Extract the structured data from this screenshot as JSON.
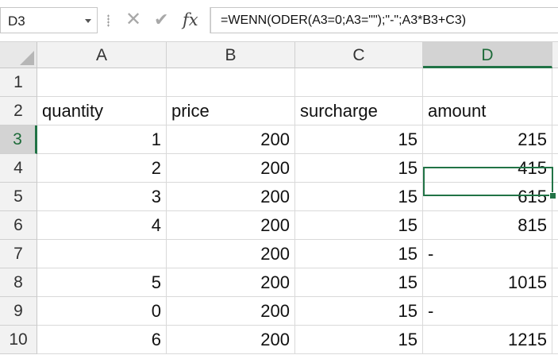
{
  "formula_bar": {
    "name_box": "D3",
    "cancel_icon": "cancel-x-icon",
    "enter_icon": "check-icon",
    "function_icon": "fx",
    "formula": "=WENN(ODER(A3=0;A3=\"\");\"-\";A3*B3+C3)"
  },
  "columns": [
    "A",
    "B",
    "C",
    "D"
  ],
  "selected_column": "D",
  "rows": [
    {
      "num": "1",
      "cells": [
        "",
        "",
        "",
        ""
      ]
    },
    {
      "num": "2",
      "cells": [
        "quantity",
        "price",
        "surcharge",
        "amount"
      ]
    },
    {
      "num": "3",
      "cells": [
        "1",
        "200",
        "15",
        "215"
      ]
    },
    {
      "num": "4",
      "cells": [
        "2",
        "200",
        "15",
        "415"
      ]
    },
    {
      "num": "5",
      "cells": [
        "3",
        "200",
        "15",
        "615"
      ]
    },
    {
      "num": "6",
      "cells": [
        "4",
        "200",
        "15",
        "815"
      ]
    },
    {
      "num": "7",
      "cells": [
        "",
        "200",
        "15",
        "-"
      ]
    },
    {
      "num": "8",
      "cells": [
        "5",
        "200",
        "15",
        "1015"
      ]
    },
    {
      "num": "9",
      "cells": [
        "0",
        "200",
        "15",
        "-"
      ]
    },
    {
      "num": "10",
      "cells": [
        "6",
        "200",
        "15",
        "1215"
      ]
    }
  ],
  "active_cell": "D3",
  "colors": {
    "accent": "#217346",
    "header_bg": "#f2f2f2",
    "selected_header_bg": "#d3d3d3"
  }
}
